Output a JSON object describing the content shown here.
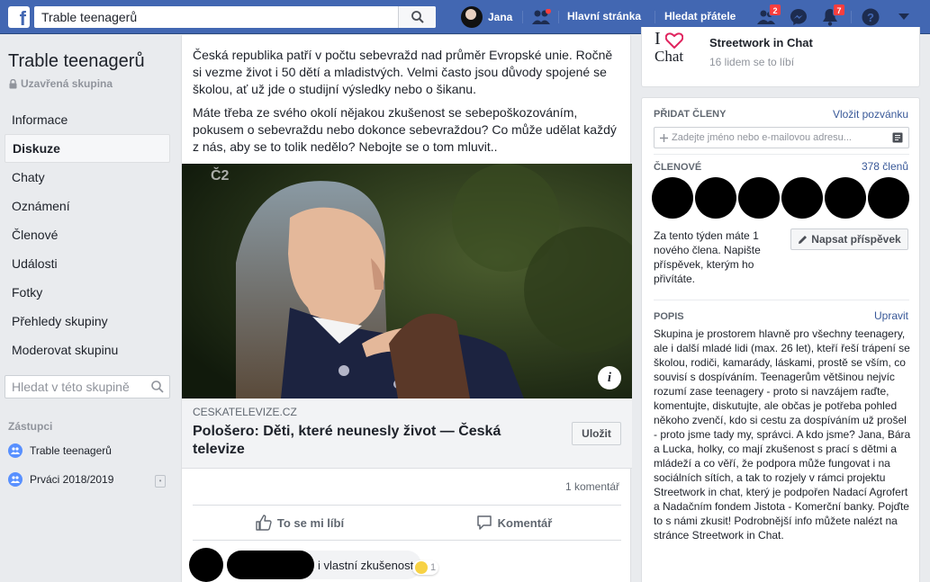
{
  "topbar": {
    "search_value": "Trable teenagerů",
    "user_name": "Jana",
    "home_label": "Hlavní stránka",
    "find_friends_label": "Hledat přátele",
    "friend_requests_badge": "2",
    "notifications_badge": "7",
    "brand_color": "#4267b2"
  },
  "sidebar": {
    "group_name": "Trable teenagerů",
    "group_type": "Uzavřená skupina",
    "items": [
      {
        "label": "Informace"
      },
      {
        "label": "Diskuze"
      },
      {
        "label": "Chaty"
      },
      {
        "label": "Oznámení"
      },
      {
        "label": "Členové"
      },
      {
        "label": "Události"
      },
      {
        "label": "Fotky"
      },
      {
        "label": "Přehledy skupiny"
      },
      {
        "label": "Moderovat skupinu"
      }
    ],
    "search_placeholder": "Hledat v této skupině",
    "shortcuts_title": "Zástupci",
    "shortcuts": [
      {
        "label": "Trable teenagerů"
      },
      {
        "label": "Prváci 2018/2019"
      }
    ]
  },
  "post": {
    "paragraph1": "Česká republika patří v počtu sebevražd nad průměr Evropské unie. Ročně si vezme život i 50 dětí a mladistvých. Velmi často jsou důvody spojené se školou, ať už jde o studijní výsledky nebo o šikanu.",
    "paragraph2": "Máte třeba ze svého okolí nějakou zkušenost se sebepoškozováním, pokusem o sebevraždu nebo dokonce sebevraždou? Co může udělat každý z nás, aby se to tolik nedělo? Nebojte se o tom mluvit..",
    "image_watermark": "Č2",
    "link_domain": "CESKATELEVIZE.CZ",
    "link_title": "Pološero: Děti, které neunesly život — Česká televize",
    "save_label": "Uložit",
    "comment_count": "1 komentář",
    "like_label": "To se mi líbí",
    "comment_label": "Komentář",
    "comment_text": "i vlastní zkušenost",
    "comment_reactions": "1"
  },
  "page_card": {
    "name": "Streetwork in Chat",
    "likes": "16 lidem se to líbí",
    "logo_text_top": "I",
    "logo_text_bottom": "Chat"
  },
  "members_card": {
    "add_title": "PŘIDAT ČLENY",
    "invite_link": "Vložit pozvánku",
    "invite_placeholder": "Zadejte jméno nebo e-mailovou adresu...",
    "members_title": "ČLENOVÉ",
    "members_count": "378 členů",
    "new_member_text": "Za tento týden máte 1 nového člena. Napište příspěvek, kterým ho přivítáte.",
    "write_post_label": "Napsat příspěvek",
    "desc_title": "POPIS",
    "edit_link": "Upravit",
    "description": "Skupina je prostorem hlavně pro všechny teenagery, ale i další mladé lidi (max. 26 let), kteří řeší trápení se školou, rodiči, kamarády, láskami, prostě se vším, co souvisí s dospíváním. Teenagerům většinou nejvíc rozumí zase teenagery - proto si navzájem raďte, komentujte, diskutujte, ale občas je potřeba pohled někoho zvenčí, kdo si cestu za dospíváním už prošel - proto jsme tady my, správci. A kdo jsme? Jana, Bára a Lucka, holky, co mají zkušenost s prací s dětmi a mládeží a co věří, že podpora může fungovat i na sociálních sítích, a tak to rozjely v rámci projektu Streetwork in chat, který je podpořen Nadací Agrofert a Nadačním fondem Jistota - Komerční banky. Pojďte to s námi zkusit! Podrobnější info můžete nalézt na stránce Streetwork in Chat."
  }
}
